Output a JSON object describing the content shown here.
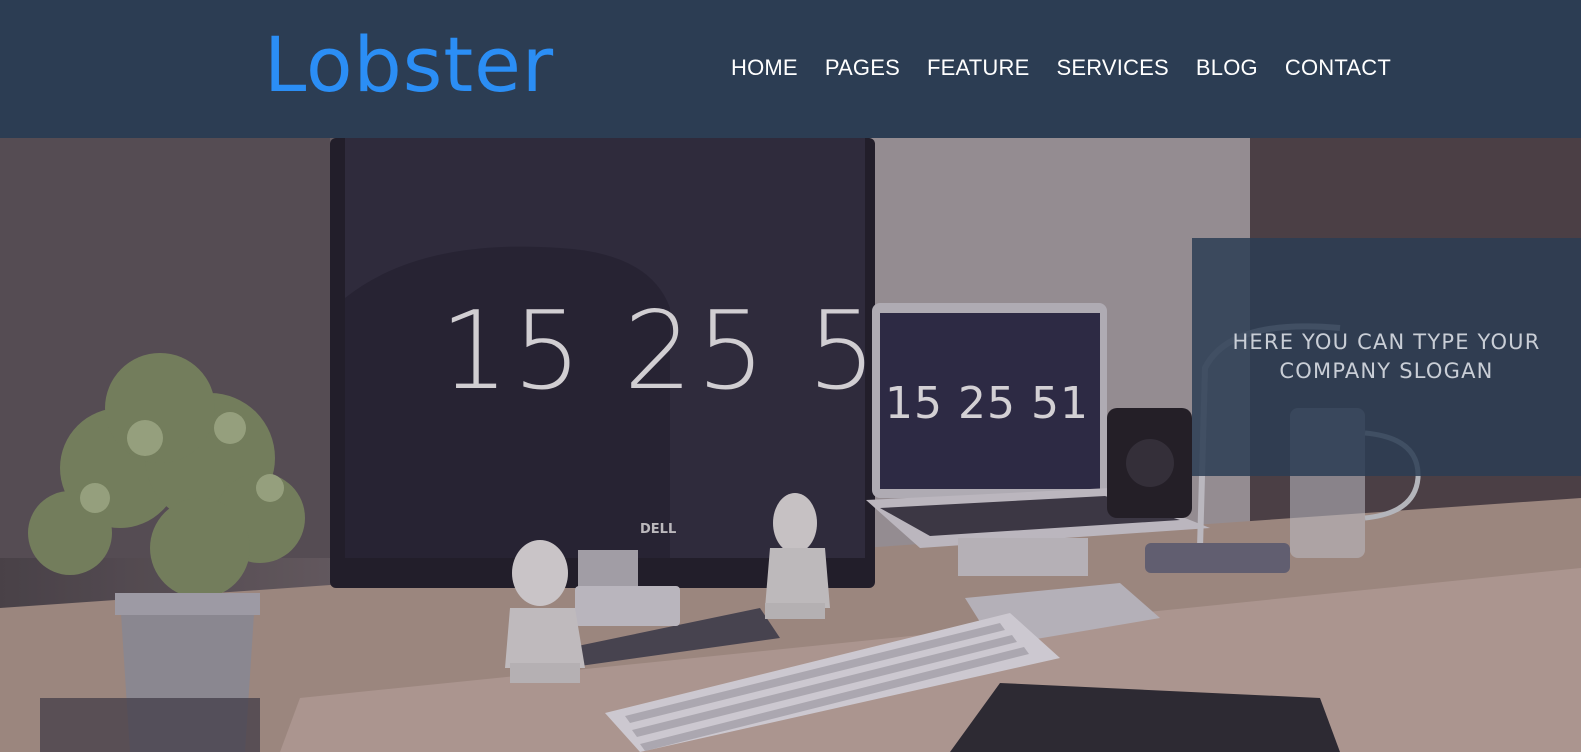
{
  "brand": {
    "name": "Lobster",
    "color": "#2b8ef5"
  },
  "nav": {
    "items": [
      {
        "label": "HOME"
      },
      {
        "label": "PAGES"
      },
      {
        "label": "FEATURE"
      },
      {
        "label": "SERVICES"
      },
      {
        "label": "BLOG"
      },
      {
        "label": "CONTACT"
      }
    ]
  },
  "hero": {
    "monitor_clock": "15 25 51",
    "laptop_clock": "15 25 51",
    "monitor_brand": "DELL",
    "slogan": "HERE YOU CAN TYPE YOUR COMPANY SLOGAN"
  },
  "colors": {
    "header_bg": "#2c3d53",
    "nav_text": "#ffffff",
    "slogan_bg": "#2c3d53"
  }
}
